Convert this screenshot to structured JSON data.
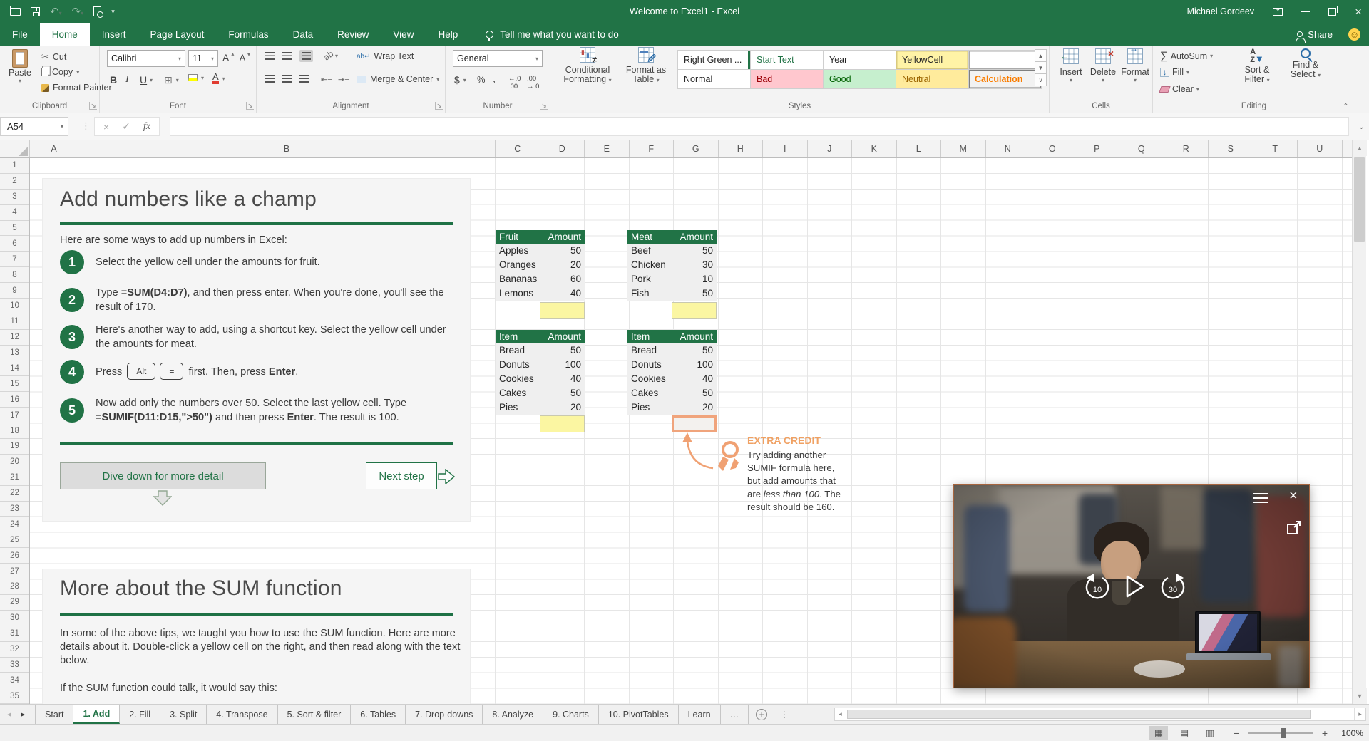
{
  "chrome": {
    "title": "Welcome to Excel1  -  Excel",
    "user_name": "Michael Gordeev",
    "share_label": "Share",
    "tell_me": "Tell me what you want to do",
    "tabs": [
      "File",
      "Home",
      "Insert",
      "Page Layout",
      "Formulas",
      "Data",
      "Review",
      "View",
      "Help"
    ],
    "active_tab": "Home"
  },
  "ribbon": {
    "clipboard": {
      "label": "Clipboard",
      "paste": "Paste",
      "cut": "Cut",
      "copy": "Copy",
      "format_painter": "Format Painter"
    },
    "font": {
      "label": "Font",
      "family": "Calibri",
      "size": "11"
    },
    "alignment": {
      "label": "Alignment",
      "wrap": "Wrap Text",
      "merge": "Merge & Center"
    },
    "number": {
      "label": "Number",
      "format": "General"
    },
    "styles": {
      "label": "Styles",
      "conditional_formatting": "Conditional Formatting",
      "format_as_table": "Format as Table",
      "gallery": [
        [
          {
            "label": "Right Green ...",
            "fg": "#262626",
            "bg": "#ffffff",
            "edge": "#217346"
          },
          {
            "label": "Start Text",
            "fg": "#217346",
            "bg": "#ffffff"
          },
          {
            "label": "Year",
            "fg": "#262626",
            "bg": "#ffffff"
          },
          {
            "label": "YellowCell",
            "fg": "#262626",
            "bg": "#FFF3A6",
            "border": "#d8c97e"
          },
          {
            "label": "",
            "fg": "#262626",
            "bg": "#ffffff",
            "border": "#ababab"
          }
        ],
        [
          {
            "label": "Normal",
            "fg": "#262626",
            "bg": "#ffffff"
          },
          {
            "label": "Bad",
            "fg": "#9C0006",
            "bg": "#FFC7CE"
          },
          {
            "label": "Good",
            "fg": "#006100",
            "bg": "#C6EFCE"
          },
          {
            "label": "Neutral",
            "fg": "#9C6500",
            "bg": "#FFEB9C"
          },
          {
            "label": "Calculation",
            "fg": "#FA7D00",
            "bg": "#F2F2F2",
            "border": "#7F7F7F",
            "bold": true
          }
        ]
      ]
    },
    "cells": {
      "label": "Cells",
      "insert": "Insert",
      "delete": "Delete",
      "format": "Format"
    },
    "editing": {
      "label": "Editing",
      "autosum": "AutoSum",
      "fill": "Fill",
      "clear": "Clear",
      "sort_filter": "Sort & Filter",
      "find_select": "Find & Select"
    }
  },
  "formula_bar": {
    "name_box": "A54",
    "formula": ""
  },
  "grid": {
    "col_letters": [
      "A",
      "B",
      "C",
      "D",
      "E",
      "F",
      "G",
      "H",
      "I",
      "J",
      "K",
      "L",
      "M",
      "N",
      "O",
      "P",
      "Q",
      "R",
      "S",
      "T",
      "U"
    ],
    "row_count": 35
  },
  "lesson": {
    "card1": {
      "title": "Add numbers like a champ",
      "intro": "Here are some ways to add up numbers in Excel:",
      "steps": [
        {
          "num": "1",
          "runs": [
            {
              "t": "Select the yellow cell under the amounts for fruit."
            }
          ]
        },
        {
          "num": "2",
          "runs": [
            {
              "t": "Type ="
            },
            {
              "t": "SUM(D4:D7)",
              "b": true
            },
            {
              "t": ", and then press enter. When you're done, you'll see the result of 170."
            }
          ]
        },
        {
          "num": "3",
          "runs": [
            {
              "t": "Here's another way to add, using a shortcut key. Select the yellow cell under the amounts for meat."
            }
          ]
        },
        {
          "num": "4",
          "runs": [
            {
              "t": "Press "
            },
            {
              "key": "Alt"
            },
            {
              "key": "="
            },
            {
              "t": " first. Then, press "
            },
            {
              "t": "Enter",
              "b": true
            },
            {
              "t": "."
            }
          ]
        },
        {
          "num": "5",
          "runs": [
            {
              "t": "Now add only the numbers over 50. Select the last yellow cell. Type "
            },
            {
              "t": "=SUMIF(D11:D15,\">50\")",
              "b": true
            },
            {
              "t": " and then press "
            },
            {
              "t": "Enter",
              "b": true
            },
            {
              "t": ". The result is 100."
            }
          ]
        }
      ],
      "dive_button": "Dive down for more detail",
      "next_button": "Next step"
    },
    "tables": [
      {
        "id": "fruit",
        "headers": [
          "Fruit",
          "Amount"
        ],
        "rows": [
          [
            "Apples",
            "50"
          ],
          [
            "Oranges",
            "20"
          ],
          [
            "Bananas",
            "60"
          ],
          [
            "Lemons",
            "40"
          ]
        ],
        "answer_cell": "yellow"
      },
      {
        "id": "meat",
        "headers": [
          "Meat",
          "Amount"
        ],
        "rows": [
          [
            "Beef",
            "50"
          ],
          [
            "Chicken",
            "30"
          ],
          [
            "Pork",
            "10"
          ],
          [
            "Fish",
            "50"
          ]
        ],
        "answer_cell": "yellow"
      },
      {
        "id": "items-left",
        "headers": [
          "Item",
          "Amount"
        ],
        "rows": [
          [
            "Bread",
            "50"
          ],
          [
            "Donuts",
            "100"
          ],
          [
            "Cookies",
            "40"
          ],
          [
            "Cakes",
            "50"
          ],
          [
            "Pies",
            "20"
          ]
        ],
        "answer_cell": "yellow"
      },
      {
        "id": "items-right",
        "headers": [
          "Item",
          "Amount"
        ],
        "rows": [
          [
            "Bread",
            "50"
          ],
          [
            "Donuts",
            "100"
          ],
          [
            "Cookies",
            "40"
          ],
          [
            "Cakes",
            "50"
          ],
          [
            "Pies",
            "20"
          ]
        ],
        "answer_cell": "orange"
      }
    ],
    "extra_credit": {
      "title": "EXTRA CREDIT",
      "runs": [
        {
          "t": "Try adding another SUMIF formula here, but add amounts that are "
        },
        {
          "t": "less than 100",
          "i": true
        },
        {
          "t": ". The result should be 160."
        }
      ]
    },
    "card2": {
      "title": "More about the SUM function",
      "para1": "In some of the above tips, we taught you how to use the SUM function. Here are more details about it. Double-click a yellow cell on the right, and then read along with the text below.",
      "para2": "If the SUM function could talk, it would say this:"
    }
  },
  "video": {
    "rewind_label": "10",
    "forward_label": "30"
  },
  "sheet_tabs": {
    "tabs": [
      "Start",
      "1. Add",
      "2. Fill",
      "3. Split",
      "4. Transpose",
      "5. Sort & filter",
      "6. Tables",
      "7. Drop-downs",
      "8. Analyze",
      "9. Charts",
      "10. PivotTables",
      "Learn",
      "…"
    ],
    "active": "1. Add"
  },
  "status_bar": {
    "zoom": "100%"
  },
  "colors": {
    "excel_green": "#217346",
    "yellow_cell": "#FBF6A2",
    "orange_accent": "#F0A173",
    "video_progress_red": "#E8112D"
  }
}
